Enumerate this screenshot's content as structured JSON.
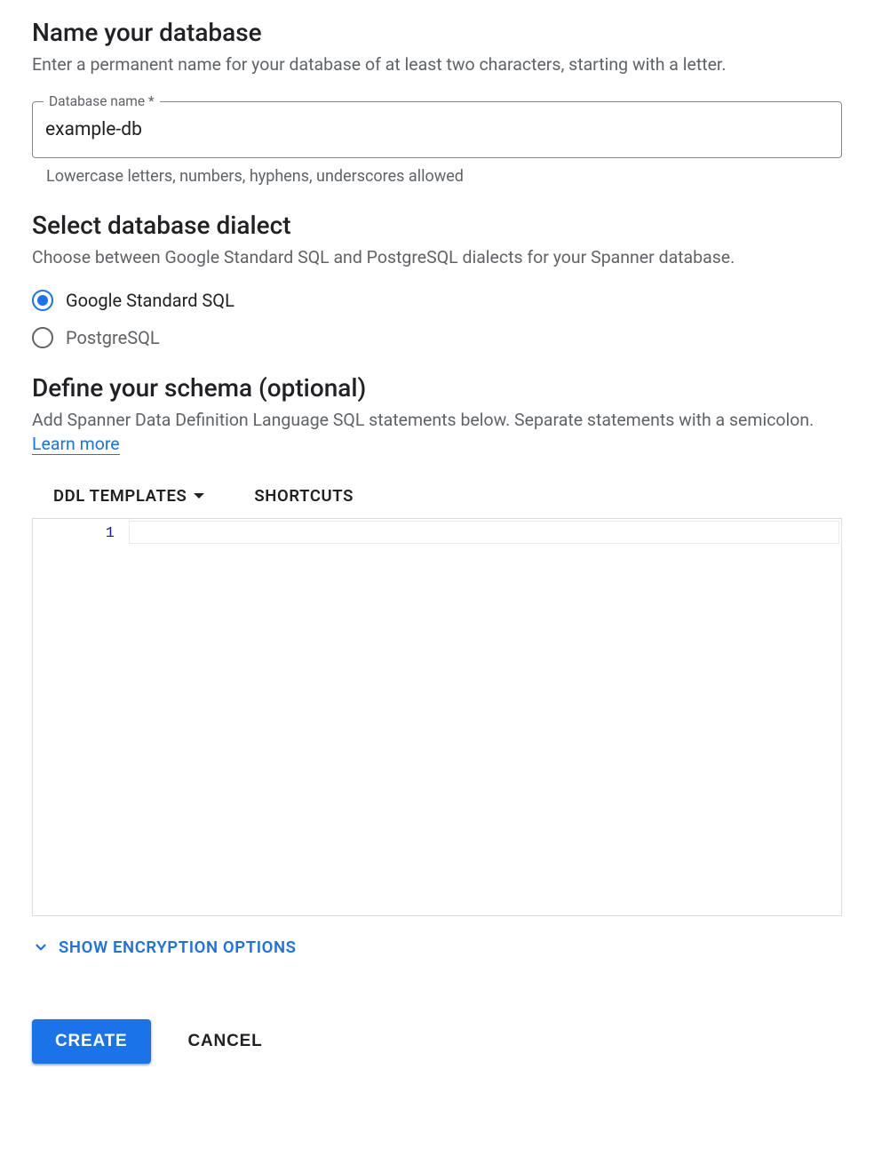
{
  "name_section": {
    "title": "Name your database",
    "desc": "Enter a permanent name for your database of at least two characters, starting with a letter.",
    "field_label": "Database name *",
    "field_value": "example-db",
    "helper": "Lowercase letters, numbers, hyphens, underscores allowed"
  },
  "dialect_section": {
    "title": "Select database dialect",
    "desc": "Choose between Google Standard SQL and PostgreSQL dialects for your Spanner database.",
    "options": [
      {
        "label": "Google Standard SQL",
        "selected": true
      },
      {
        "label": "PostgreSQL",
        "selected": false
      }
    ]
  },
  "schema_section": {
    "title": "Define your schema (optional)",
    "desc_prefix": "Add Spanner Data Definition Language SQL statements below. Separate statements with a semicolon. ",
    "learn_more": "Learn more",
    "toolbar": {
      "ddl_templates": "DDL TEMPLATES",
      "shortcuts": "SHORTCUTS"
    },
    "editor": {
      "line_numbers": [
        "1"
      ],
      "content": ""
    }
  },
  "encryption_toggle": "SHOW ENCRYPTION OPTIONS",
  "buttons": {
    "create": "CREATE",
    "cancel": "CANCEL"
  }
}
